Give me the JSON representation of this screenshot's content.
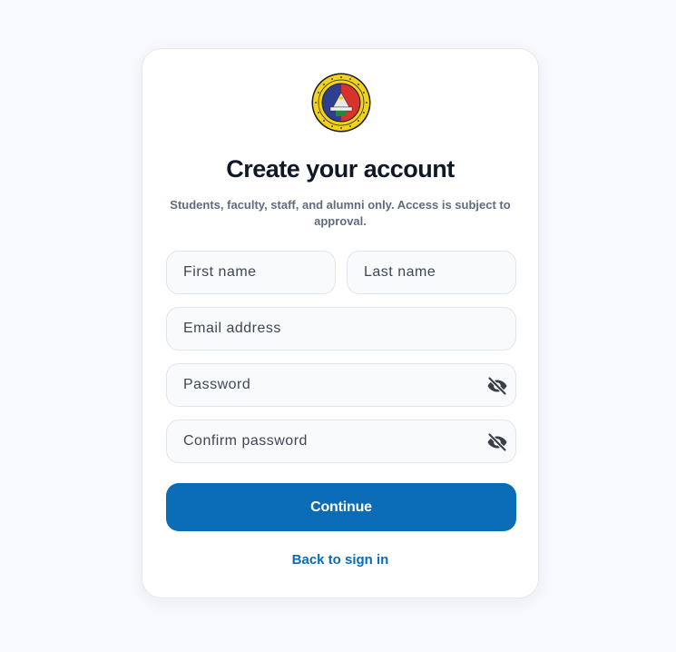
{
  "logo": {
    "name": "university-seal"
  },
  "heading": {
    "title": "Create your account",
    "subtitle": "Students, faculty, staff, and alumni only. Access is subject to approval."
  },
  "form": {
    "first_name": {
      "placeholder": "First name",
      "value": ""
    },
    "last_name": {
      "placeholder": "Last name",
      "value": ""
    },
    "email": {
      "placeholder": "Email address",
      "value": ""
    },
    "password": {
      "placeholder": "Password",
      "value": "",
      "icon": "eye-off-icon"
    },
    "confirm_password": {
      "placeholder": "Confirm password",
      "value": "",
      "icon": "eye-off-icon"
    }
  },
  "actions": {
    "continue_label": "Continue",
    "back_label": "Back to sign in"
  },
  "colors": {
    "primary": "#0a6bb6",
    "title": "#101828",
    "muted": "#5f6b80",
    "background": "#f7f9fc"
  }
}
